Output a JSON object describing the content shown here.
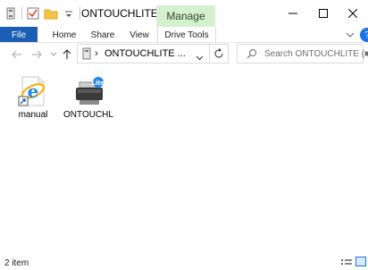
{
  "window": {
    "title": "ONTOUCHLITE",
    "title_suffix": "(■)",
    "context_tab": "Manage"
  },
  "ribbon": {
    "file_label": "File",
    "tabs": [
      {
        "label": "Home"
      },
      {
        "label": "Share"
      },
      {
        "label": "View"
      },
      {
        "label": "Drive Tools"
      }
    ]
  },
  "address": {
    "path": "ONTOUCHLITE ..."
  },
  "search": {
    "placeholder": "Search ONTOUCHLITE (■)"
  },
  "files": [
    {
      "name": "manual",
      "icon": "internet-explorer-shortcut-icon"
    },
    {
      "name": "ONTOUCHL",
      "icon": "scanner-app-icon"
    }
  ],
  "status": {
    "item_count": "2 item"
  },
  "colors": {
    "file_tab": "#1a5fb4",
    "manage_tab": "#d5f0ce",
    "ie_blue": "#1e88e5",
    "ie_ring": "#f4b400",
    "accent": "#1a73e8"
  }
}
